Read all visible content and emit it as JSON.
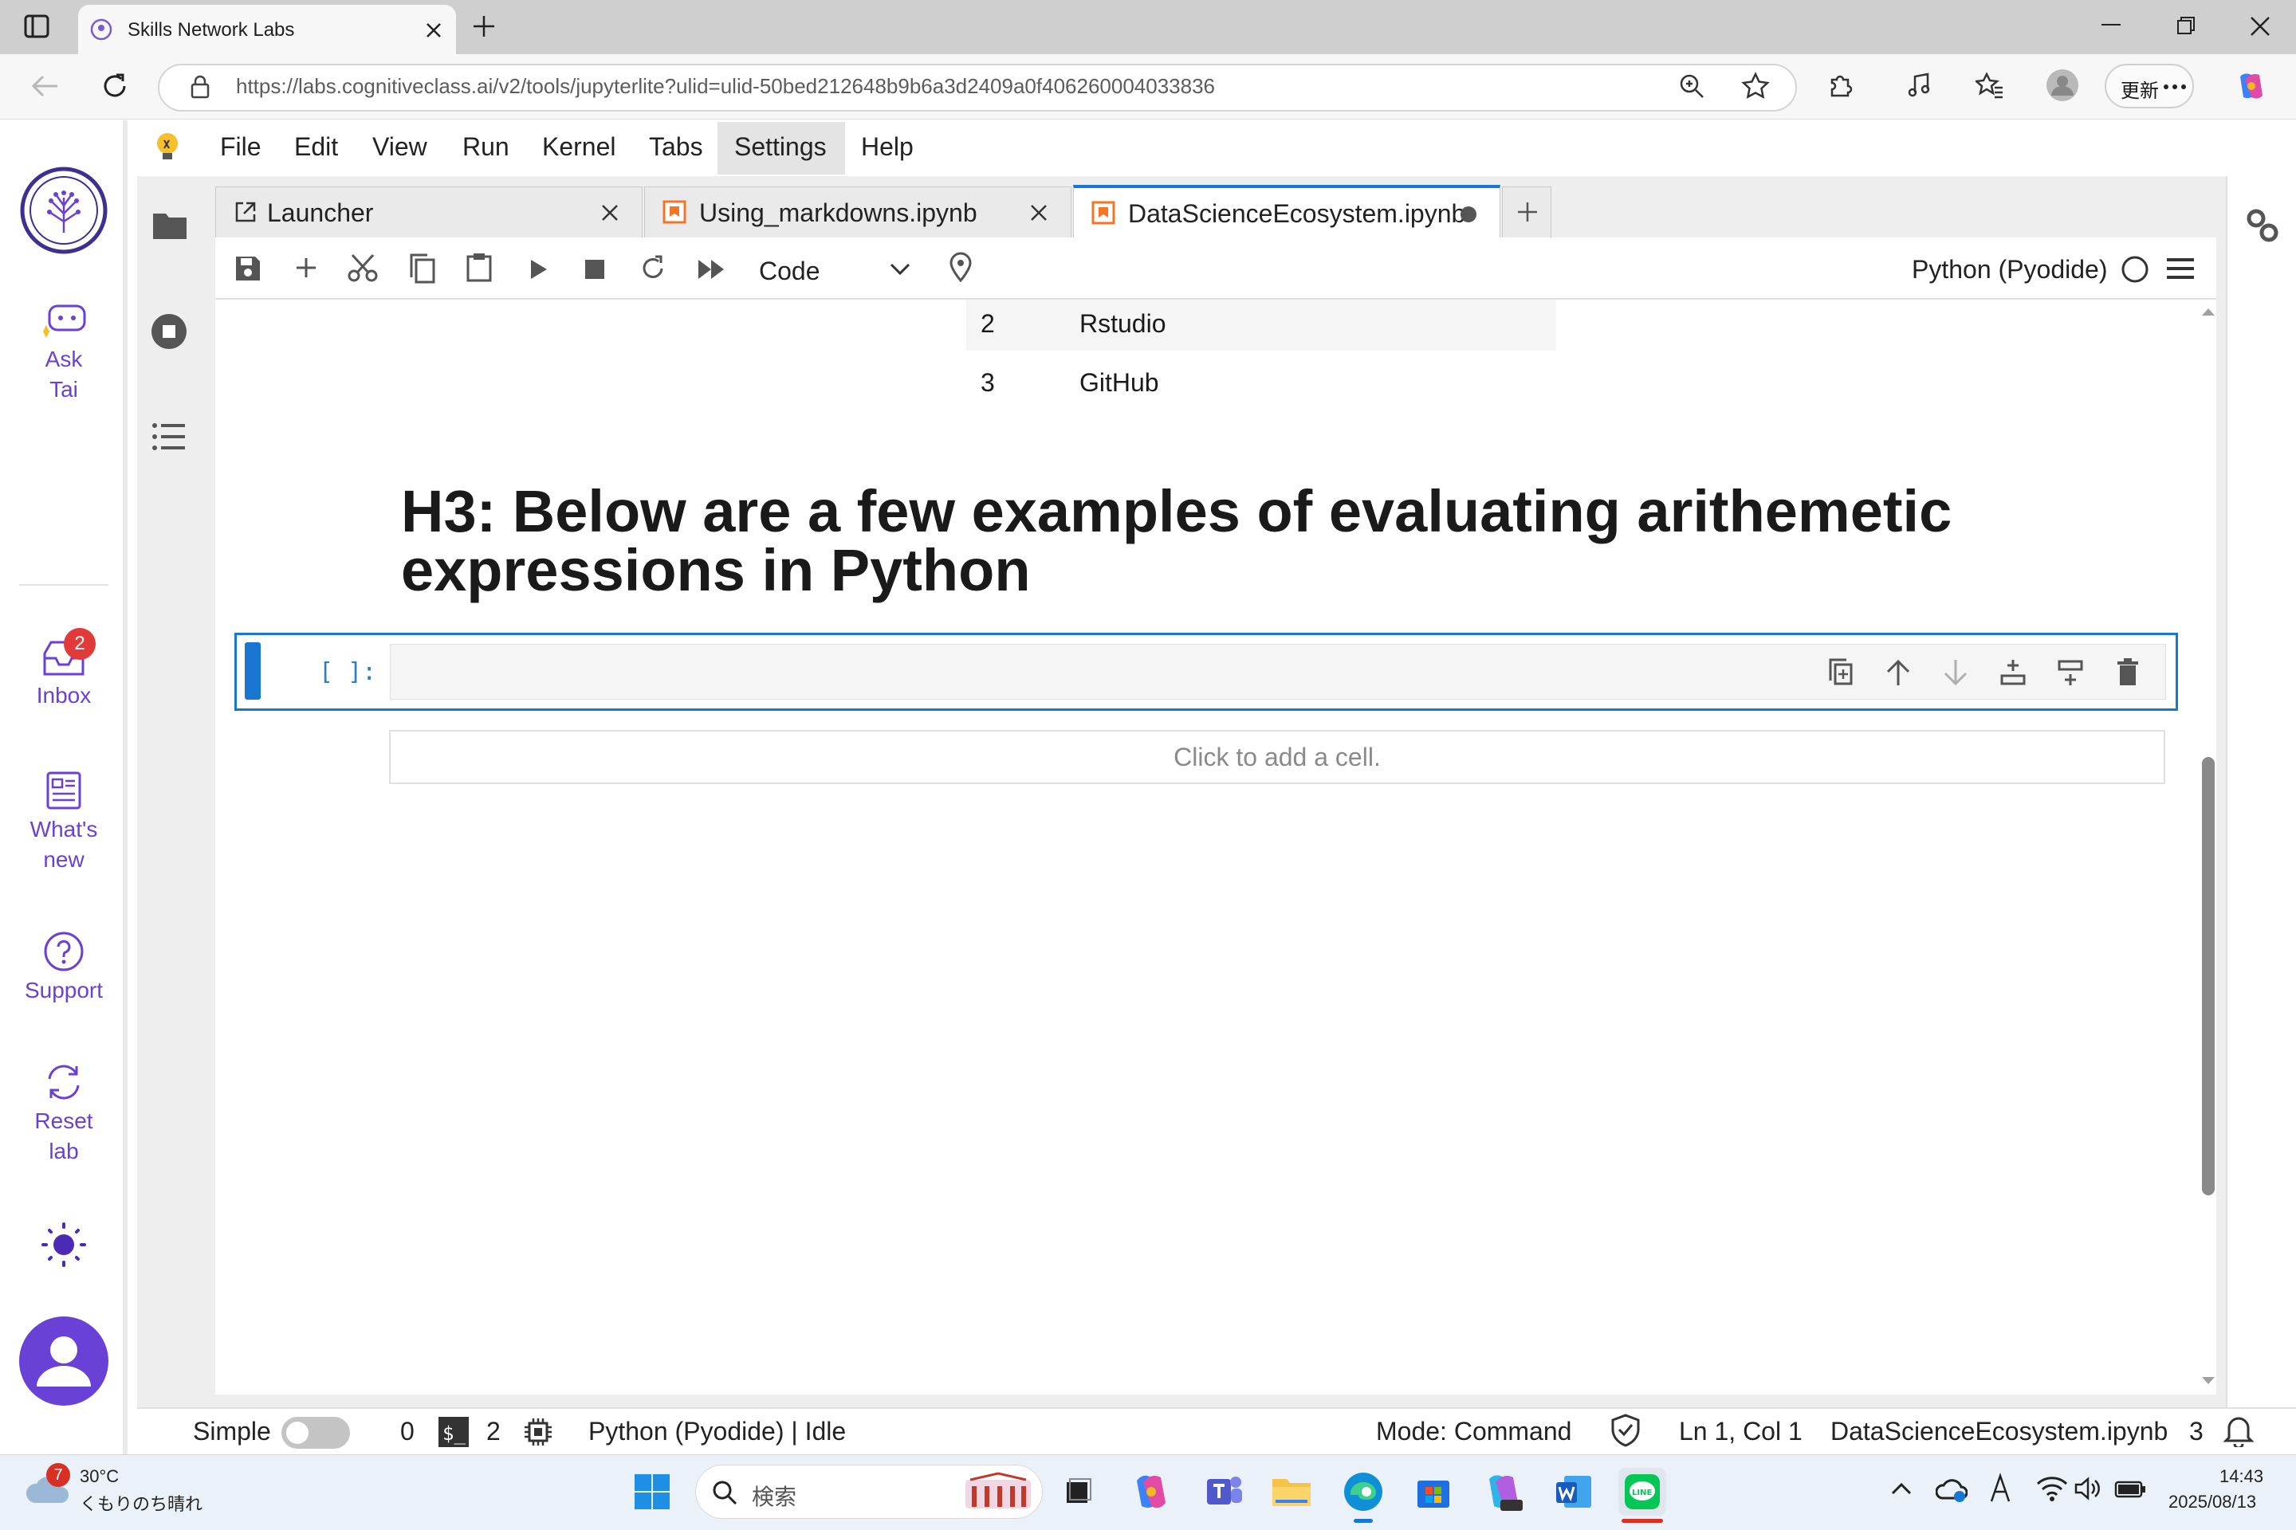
{
  "browser": {
    "tab_title": "Skills Network Labs",
    "url": "https://labs.cognitiveclass.ai/v2/tools/jupyterlite?ulid=ulid-50bed212648b9b6a3d2409a0f406260004033836",
    "update_label": "更新"
  },
  "rail": {
    "ask_tai": "Ask Tai",
    "inbox": "Inbox",
    "inbox_badge": "2",
    "whats_new_1": "What's",
    "whats_new_2": "new",
    "support": "Support",
    "reset_1": "Reset",
    "reset_2": "lab"
  },
  "menu": [
    "File",
    "Edit",
    "View",
    "Run",
    "Kernel",
    "Tabs",
    "Settings",
    "Help"
  ],
  "tabs": [
    {
      "label": "Launcher"
    },
    {
      "label": "Using_markdowns.ipynb"
    },
    {
      "label": "DataScienceEcosystem.ipynb"
    }
  ],
  "toolbar": {
    "cell_type": "Code",
    "kernel_name": "Python (Pyodide)"
  },
  "notebook": {
    "table_rows": [
      {
        "num": "2",
        "name": "Rstudio"
      },
      {
        "num": "3",
        "name": "GitHub"
      }
    ],
    "heading": "H3: Below are a few examples of evaluating arithemetic expressions in Python",
    "cell_prompt": "[ ]:",
    "add_cell": "Click to add a cell."
  },
  "status": {
    "mode_simple": "Simple",
    "terminals": "0",
    "kernels": "2",
    "kernel_status": "Python (Pyodide) | Idle",
    "mode": "Mode: Command",
    "position": "Ln 1, Col 1",
    "filename": "DataScienceEcosystem.ipynb",
    "notifications": "3"
  },
  "taskbar": {
    "weather_temp": "30°C",
    "weather_desc": "くもりのち晴れ",
    "weather_badge": "7",
    "search_placeholder": "検索",
    "time": "14:43",
    "date": "2025/08/13"
  },
  "colors": {
    "accent_blue": "#1976d2",
    "rail_purple": "#6a41d6",
    "badge_red": "#e03a3a"
  }
}
